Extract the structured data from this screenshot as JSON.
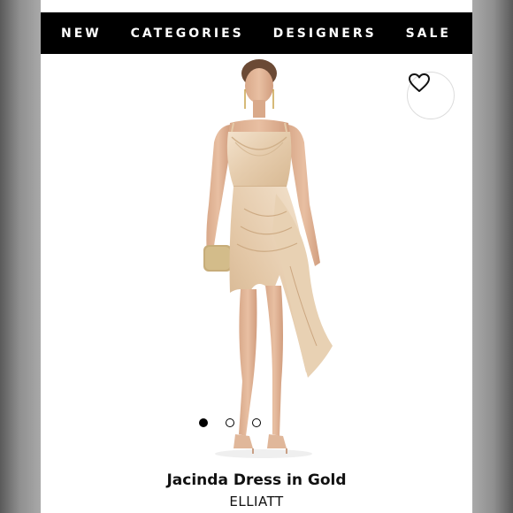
{
  "nav": {
    "items": [
      {
        "label": "NEW"
      },
      {
        "label": "CATEGORIES"
      },
      {
        "label": "DESIGNERS"
      },
      {
        "label": "SALE"
      }
    ]
  },
  "product": {
    "name": "Jacinda Dress in Gold",
    "brand": "ELLIATT",
    "image_icon": "product-photo",
    "wishlist_icon": "heart-icon"
  },
  "carousel": {
    "total": 3,
    "active_index": 0
  },
  "colors": {
    "nav_background": "#000000",
    "nav_text": "#ffffff",
    "dress": "#e9d3b8",
    "page_background": "#ffffff"
  }
}
